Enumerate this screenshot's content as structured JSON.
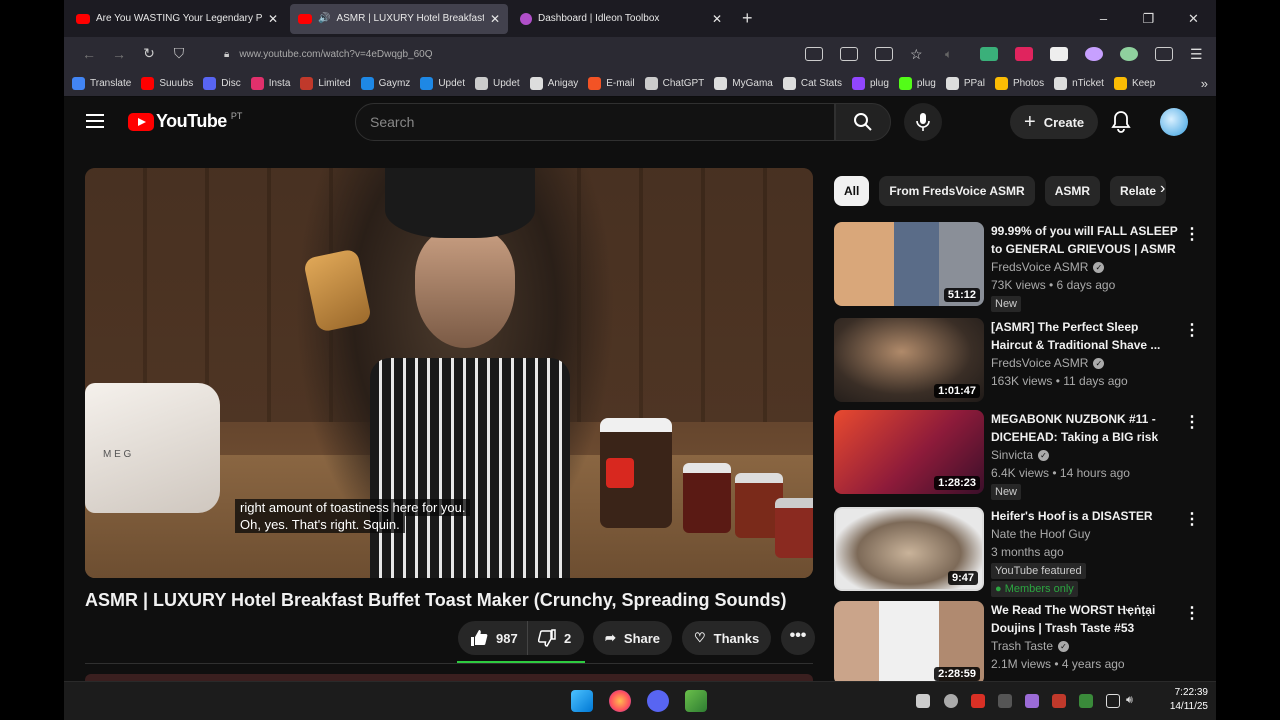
{
  "browser": {
    "tabs": [
      {
        "title": "Are You WASTING Your Legendary Po",
        "icon": "youtube-icon",
        "active": false
      },
      {
        "title": "ASMR | LUXURY Hotel Breakfast",
        "icon": "youtube-icon",
        "active": true,
        "audio": "speaker-icon"
      },
      {
        "title": "Dashboard | Idleon Toolbox",
        "icon": "idleon-icon",
        "active": false
      }
    ],
    "new_tab": "+",
    "window_controls": [
      "–",
      "❐",
      "✕"
    ],
    "url": "www.youtube.com/watch?v=4eDwqgb_60Q",
    "bookmarks": [
      {
        "label": "Translate",
        "color": "#4285f4"
      },
      {
        "label": "Suuubs",
        "color": "#ff0000"
      },
      {
        "label": "Disc",
        "color": "#5865f2"
      },
      {
        "label": "Insta",
        "color": "#e1306c"
      },
      {
        "label": "Limited",
        "color": "#c0392b"
      },
      {
        "label": "Gaymz",
        "color": "#1e88e5"
      },
      {
        "label": "Updet",
        "color": "#1e88e5"
      },
      {
        "label": "Updet",
        "color": "#cccccc"
      },
      {
        "label": "Anigay",
        "color": "#dddddd"
      },
      {
        "label": "E-mail",
        "color": "#f35325"
      },
      {
        "label": "ChatGPT",
        "color": "#cccccc"
      },
      {
        "label": "MyGama",
        "color": "#dddddd"
      },
      {
        "label": "Cat Stats",
        "color": "#dddddd"
      },
      {
        "label": "plug",
        "color": "#9146ff"
      },
      {
        "label": "plug",
        "color": "#53fc18"
      },
      {
        "label": "PPal",
        "color": "#dddddd"
      },
      {
        "label": "Photos",
        "color": "#fbbc04"
      },
      {
        "label": "nTicket",
        "color": "#dddddd"
      },
      {
        "label": "Keep",
        "color": "#fbbc04"
      }
    ]
  },
  "youtube": {
    "logo_text": "YouTube",
    "country_code": "PT",
    "search_placeholder": "Search",
    "create_label": "Create"
  },
  "video": {
    "caption_line1": "right amount of toastiness here for you.",
    "caption_line2": "Oh, yes. That's right. Squin.",
    "toaster_text": "M    E    G",
    "title": "ASMR | LUXURY Hotel Breakfast Buffet Toast Maker (Crunchy, Spreading Sounds)",
    "likes": "987",
    "dislikes": "2",
    "share_label": "Share",
    "thanks_label": "Thanks",
    "more": "•••"
  },
  "chips": [
    {
      "label": "All",
      "active": true
    },
    {
      "label": "From FredsVoice ASMR",
      "active": false
    },
    {
      "label": "ASMR",
      "active": false
    },
    {
      "label": "Relate",
      "active": false
    }
  ],
  "recommendations": [
    {
      "title": "99.99% of you will FALL ASLEEP to GENERAL GRIEVOUS | ASMR",
      "channel": "FredsVoice ASMR",
      "verified": true,
      "meta": "73K views • 6 days ago",
      "badge": "New",
      "badge_style": "",
      "duration": "51:12"
    },
    {
      "title": "[ASMR] The Perfect Sleep Haircut & Traditional Shave ...",
      "channel": "FredsVoice ASMR",
      "verified": true,
      "meta": "163K views • 11 days ago",
      "badge": "",
      "badge_style": "",
      "duration": "1:01:47"
    },
    {
      "title": "MEGABONK NUZBONK #11 - DICEHEAD: Taking a BIG risk",
      "channel": "Sinvicta",
      "verified": true,
      "meta": "6.4K views • 14 hours ago",
      "badge": "New",
      "badge_style": "",
      "duration": "1:28:23"
    },
    {
      "title": "Heifer's Hoof is a DISASTER",
      "channel": "Nate the Hoof Guy",
      "verified": false,
      "meta": "3 months ago",
      "badge": "YouTube featured",
      "badge2": "Members only",
      "duration": "9:47"
    },
    {
      "title": "We Read The WORST Ⲏҿṅṭại Doujins | Trash Taste #53",
      "channel": "Trash Taste",
      "verified": true,
      "meta": "2.1M views • 4 years ago",
      "badge": "",
      "duration": "2:28:59"
    }
  ],
  "taskbar": {
    "time": "7:22:39",
    "date": "14/11/25"
  }
}
